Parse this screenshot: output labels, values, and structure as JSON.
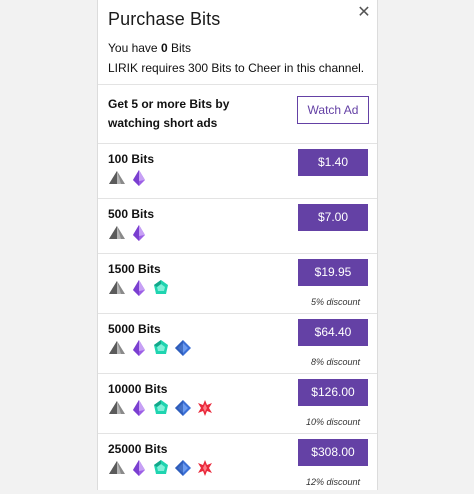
{
  "dialog": {
    "title": "Purchase Bits",
    "balance_prefix": "You have ",
    "balance_amount": "0",
    "balance_suffix": " Bits",
    "requirement": "LIRIK requires 300 Bits to Cheer in this channel."
  },
  "ads": {
    "text": "Get 5 or more Bits by watching short ads",
    "button_label": "Watch Ad"
  },
  "tiers": [
    {
      "name": "100 Bits",
      "price": "$1.40",
      "discount": "",
      "gems": [
        "gray-gem-icon",
        "purple-gem-icon"
      ]
    },
    {
      "name": "500 Bits",
      "price": "$7.00",
      "discount": "",
      "gems": [
        "gray-gem-icon",
        "purple-gem-icon"
      ]
    },
    {
      "name": "1500 Bits",
      "price": "$19.95",
      "discount": "5% discount",
      "gems": [
        "gray-gem-icon",
        "purple-gem-icon",
        "teal-gem-icon"
      ]
    },
    {
      "name": "5000 Bits",
      "price": "$64.40",
      "discount": "8% discount",
      "gems": [
        "gray-gem-icon",
        "purple-gem-icon",
        "teal-gem-icon",
        "blue-gem-icon"
      ]
    },
    {
      "name": "10000 Bits",
      "price": "$126.00",
      "discount": "10% discount",
      "gems": [
        "gray-gem-icon",
        "purple-gem-icon",
        "teal-gem-icon",
        "blue-gem-icon",
        "red-star-gem-icon"
      ]
    },
    {
      "name": "25000 Bits",
      "price": "$308.00",
      "discount": "12% discount",
      "gems": [
        "gray-gem-icon",
        "purple-gem-icon",
        "teal-gem-icon",
        "blue-gem-icon",
        "red-star-gem-icon"
      ]
    }
  ],
  "colors": {
    "accent": "#6441a5",
    "gem_gray": "#8a8a8a",
    "gem_purple": "#9c5fe6",
    "gem_teal": "#1fd4b0",
    "gem_blue": "#3b6fd6",
    "gem_red": "#e9283a"
  }
}
